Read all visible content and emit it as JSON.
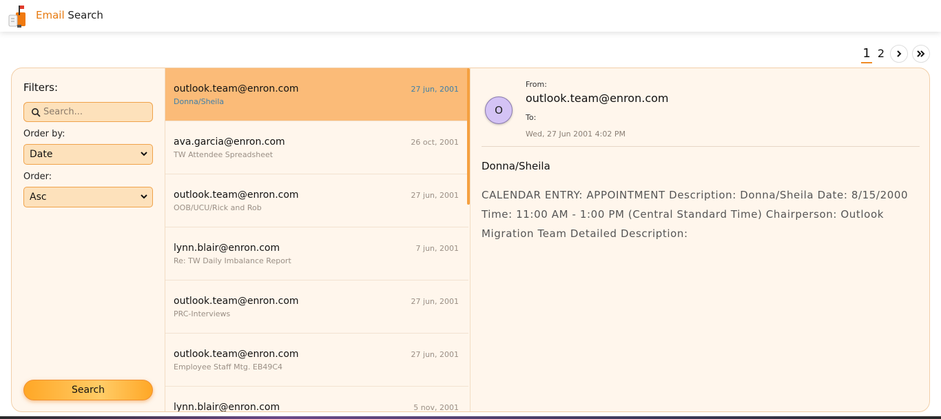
{
  "header": {
    "brand_part1": "Email ",
    "brand_part2": "Search"
  },
  "pagination": {
    "pages": [
      "1",
      "2"
    ],
    "active_page": "1",
    "next_label": "›",
    "last_label": "»"
  },
  "filters": {
    "title": "Filters:",
    "search_placeholder": "Search...",
    "search_value": "",
    "order_by_label": "Order by:",
    "order_by_value": "Date",
    "order_label": "Order:",
    "order_value": "Asc",
    "search_button": "Search"
  },
  "emails": [
    {
      "from": "outlook.team@enron.com",
      "subject": "Donna/Sheila",
      "date": "27 jun, 2001",
      "selected": true
    },
    {
      "from": "ava.garcia@enron.com",
      "subject": "TW Attendee Spreadsheet",
      "date": "26 oct, 2001"
    },
    {
      "from": "outlook.team@enron.com",
      "subject": "OOB/UCU/Rick and Rob",
      "date": "27 jun, 2001"
    },
    {
      "from": "lynn.blair@enron.com",
      "subject": "Re: TW Daily Imbalance Report",
      "date": "7 jun, 2001"
    },
    {
      "from": "outlook.team@enron.com",
      "subject": "PRC-Interviews",
      "date": "27 jun, 2001"
    },
    {
      "from": "outlook.team@enron.com",
      "subject": "Employee Staff Mtg. EB49C4",
      "date": "27 jun, 2001"
    },
    {
      "from": "lynn.blair@enron.com",
      "subject": "",
      "date": "5 nov, 2001"
    }
  ],
  "detail": {
    "avatar_initial": "O",
    "from_label": "From:",
    "from_value": "outlook.team@enron.com",
    "to_label": "To:",
    "date": "Wed, 27 Jun 2001 4:02 PM",
    "subject": "Donna/Sheila",
    "body": "CALENDAR ENTRY: APPOINTMENT Description: Donna/Sheila Date: 8/15/2000 Time: 11:00 AM - 1:00 PM (Central Standard Time) Chairperson: Outlook Migration Team Detailed Description:"
  },
  "colors": {
    "accent": "#f08a24",
    "selected_row": "#fbbb78",
    "card_bg": "#fff6ec",
    "avatar": "#d4c3f5"
  }
}
